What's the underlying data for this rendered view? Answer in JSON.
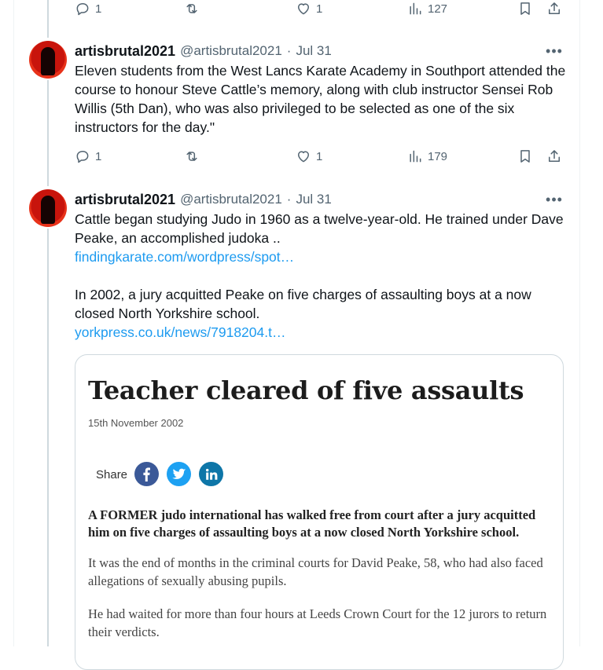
{
  "tweet0": {
    "actions": {
      "replies": "1",
      "likes": "1",
      "views": "127"
    }
  },
  "tweet1": {
    "display_name": "artisbrutal2021",
    "handle": "@artisbrutal2021",
    "separator": "·",
    "date": "Jul 31",
    "text": "Eleven students from the West Lancs Karate Academy in Southport attended  the course to honour Steve Cattle’s memory, along with club instructor Sensei  Rob Willis (5th Dan), who was also privileged to be selected as one of  the six instructors for the day.\"",
    "actions": {
      "replies": "1",
      "likes": "1",
      "views": "179"
    }
  },
  "tweet2": {
    "display_name": "artisbrutal2021",
    "handle": "@artisbrutal2021",
    "separator": "·",
    "date": "Jul 31",
    "text1": "Cattle began studying Judo in 1960 as a twelve-year-old. He trained under Dave Peake, an accomplished judoka ..",
    "link1": "findingkarate.com/wordpress/spot…",
    "text2": "In 2002, a jury acquitted Peake on five charges of assaulting boys at a now closed North Yorkshire school.",
    "link2": "yorkpress.co.uk/news/7918204.t…"
  },
  "article": {
    "title": "Teacher cleared of five assaults",
    "date": "15th November 2002",
    "share_label": "Share",
    "share_icons": [
      "facebook-icon",
      "twitter-icon",
      "linkedin-icon"
    ],
    "brand_colors": {
      "facebook": "#3b5998",
      "twitter": "#1da1f2",
      "linkedin": "#0e76a8"
    },
    "lead": "A FORMER judo international has walked free from court after a jury acquitted him on five charges of assaulting boys at a now closed North Yorkshire school.",
    "para1": "It was the end of months in the criminal courts for David Peake, 58, who had also faced allegations of sexually abusing pupils.",
    "para2": "He had waited for more than four hours at Leeds Crown Court for the 12 jurors to return their verdicts."
  },
  "icons": {
    "reply": "reply-icon",
    "retweet": "retweet-icon",
    "like": "heart-icon",
    "views": "views-icon",
    "bookmark": "bookmark-icon",
    "share": "share-icon",
    "more": "more-icon"
  },
  "colors": {
    "link": "#1d9bf0",
    "muted": "#536471",
    "text": "#0f1419"
  }
}
